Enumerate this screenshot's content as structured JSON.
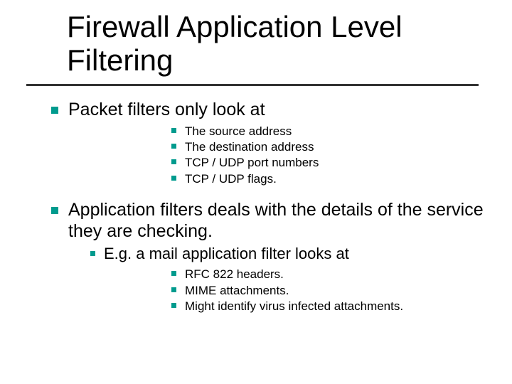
{
  "title_line1": "Firewall Application Level",
  "title_line2": "Filtering",
  "points": {
    "p1": "Packet filters only look at",
    "p1_sub": [
      "The source address",
      "The destination address",
      "TCP / UDP port numbers",
      "TCP / UDP flags."
    ],
    "p2": "Application filters deals with the details of the service they are checking.",
    "p2_sub": "E.g. a mail application filter looks at",
    "p2_sub_sub": [
      "RFC 822 headers.",
      "MIME attachments.",
      "Might identify virus infected attachments."
    ]
  }
}
